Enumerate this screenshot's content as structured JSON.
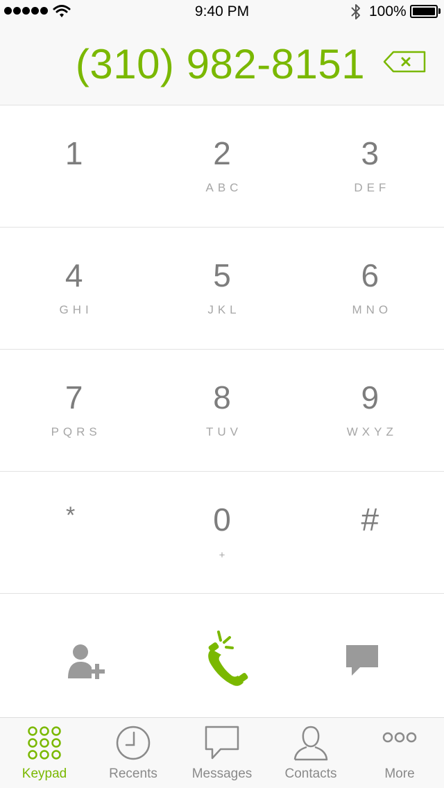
{
  "status_bar": {
    "time": "9:40 PM",
    "battery": "100%",
    "icons": [
      "signal-dots",
      "wifi-icon",
      "bluetooth-icon",
      "battery-icon"
    ]
  },
  "display": {
    "number": "(310) 982-8151",
    "backspace_icon": "backspace-icon"
  },
  "keypad": {
    "keys": [
      {
        "digit": "1",
        "letters": ""
      },
      {
        "digit": "2",
        "letters": "ABC"
      },
      {
        "digit": "3",
        "letters": "DEF"
      },
      {
        "digit": "4",
        "letters": "GHI"
      },
      {
        "digit": "5",
        "letters": "JKL"
      },
      {
        "digit": "6",
        "letters": "MNO"
      },
      {
        "digit": "7",
        "letters": "PQRS"
      },
      {
        "digit": "8",
        "letters": "TUV"
      },
      {
        "digit": "9",
        "letters": "WXYZ"
      },
      {
        "digit": "*",
        "letters": ""
      },
      {
        "digit": "0",
        "letters": "+"
      },
      {
        "digit": "#",
        "letters": ""
      }
    ]
  },
  "actions": {
    "icons": [
      "add-contact-icon",
      "call-icon",
      "message-icon"
    ]
  },
  "tabbar": {
    "tabs": [
      {
        "label": "Keypad",
        "icon": "keypad-icon",
        "active": true
      },
      {
        "label": "Recents",
        "icon": "clock-icon",
        "active": false
      },
      {
        "label": "Messages",
        "icon": "speech-bubble-icon",
        "active": false
      },
      {
        "label": "Contacts",
        "icon": "person-icon",
        "active": false
      },
      {
        "label": "More",
        "icon": "more-dots-icon",
        "active": false
      }
    ]
  },
  "colors": {
    "accent": "#7ab800",
    "key_digit": "#7d7d7d",
    "key_letters": "#a6a6a6",
    "divider": "#e2e2e2",
    "bar_background": "#f8f8f8"
  }
}
